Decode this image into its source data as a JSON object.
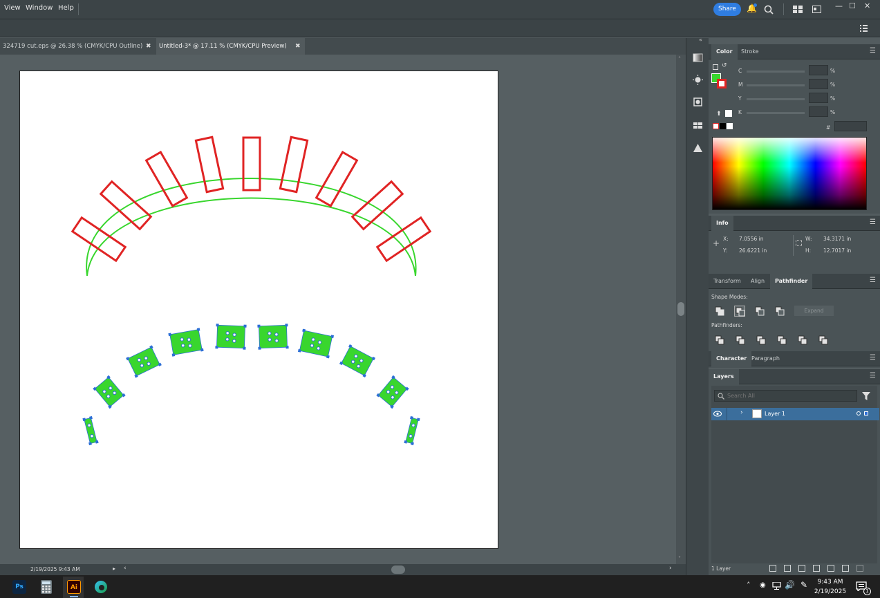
{
  "menu": {
    "items": [
      "View",
      "Window",
      "Help"
    ],
    "share_label": "Share"
  },
  "doc_tabs": [
    {
      "label": "324719 cut.eps @ 26.38 % (CMYK/CPU Outline)"
    },
    {
      "label": "Untitled-3* @ 17.11 % (CMYK/CPU Preview)"
    }
  ],
  "status": {
    "date_time": "2/19/2025  9:43 AM"
  },
  "color_panel": {
    "tabs": [
      "Color",
      "Stroke"
    ],
    "channels": [
      "C",
      "M",
      "Y",
      "K"
    ],
    "percent": "%",
    "hex_label": "#",
    "fill_color": "#39d62e",
    "stroke_color": "#e02424"
  },
  "info_panel": {
    "tab": "Info",
    "x_label": "X:",
    "x_value": "7.0556 in",
    "y_label": "Y:",
    "y_value": "26.6221 in",
    "w_label": "W:",
    "w_value": "34.3171 in",
    "h_label": "H:",
    "h_value": "12.7017 in"
  },
  "transform_panel": {
    "tabs": [
      "Transform",
      "Align",
      "Pathfinder"
    ],
    "shape_modes_label": "Shape Modes:",
    "pathfinders_label": "Pathfinders:",
    "expand_label": "Expand"
  },
  "character_panel": {
    "tabs": [
      "Character",
      "Paragraph"
    ]
  },
  "layers_panel": {
    "tab": "Layers",
    "search_placeholder": "Search All",
    "layer_name": "Layer 1",
    "footer_count": "1 Layer"
  },
  "taskbar": {
    "apps": [
      "Ps",
      "Ai"
    ],
    "time": "9:43 AM",
    "date": "2/19/2025",
    "notification_count": "1"
  },
  "colors": {
    "accent": "#2f7de1",
    "green": "#39d62e",
    "red": "#e02424",
    "selection": "#2d6fd6"
  }
}
